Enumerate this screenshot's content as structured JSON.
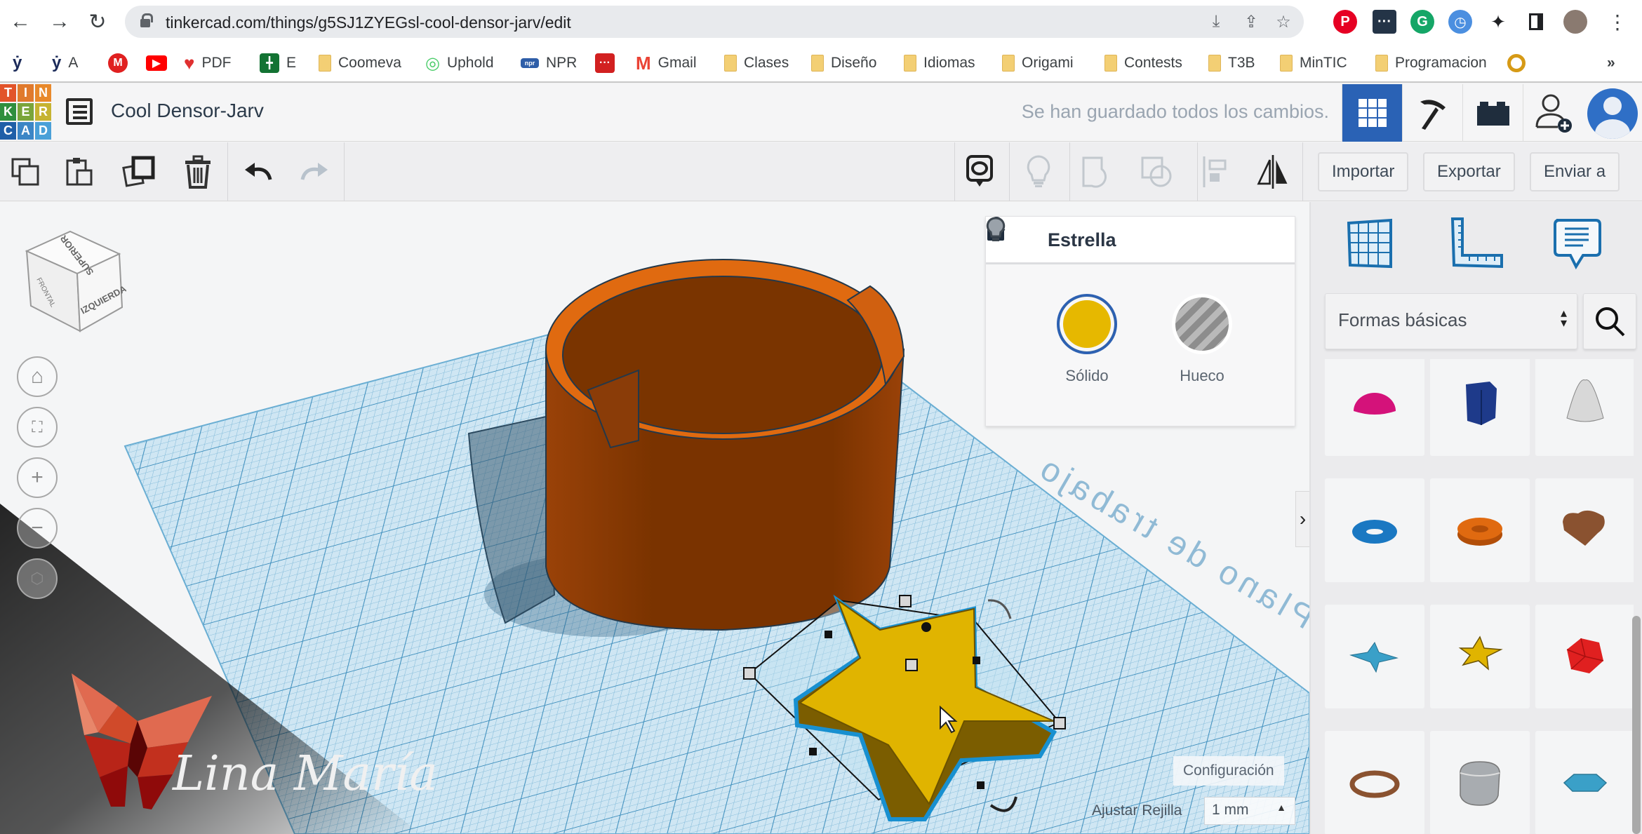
{
  "browser": {
    "url": "tinkercad.com/things/g5SJ1ZYEGsl-cool-densor-jarv/edit",
    "bookmarks": [
      {
        "label": "",
        "icon": "person-icon"
      },
      {
        "label": "A",
        "icon": "person-icon"
      },
      {
        "label": "",
        "icon": "m-badge-icon"
      },
      {
        "label": "",
        "icon": "youtube-icon"
      },
      {
        "label": "PDF",
        "icon": "pdf-heart-icon"
      },
      {
        "label": "E",
        "icon": "sheets-icon"
      },
      {
        "label": "Coomeva",
        "icon": "folder-icon"
      },
      {
        "label": "Uphold",
        "icon": "uphold-icon"
      },
      {
        "label": "NPR",
        "icon": "npr-icon"
      },
      {
        "label": "",
        "icon": "red-dots-icon"
      },
      {
        "label": "Gmail",
        "icon": "gmail-icon"
      },
      {
        "label": "Clases",
        "icon": "folder-icon"
      },
      {
        "label": "Diseño",
        "icon": "folder-icon"
      },
      {
        "label": "Idiomas",
        "icon": "folder-icon"
      },
      {
        "label": "Origami",
        "icon": "folder-icon"
      },
      {
        "label": "Contests",
        "icon": "folder-icon"
      },
      {
        "label": "T3B",
        "icon": "folder-icon"
      },
      {
        "label": "MinTIC",
        "icon": "folder-icon"
      },
      {
        "label": "Programacion",
        "icon": "folder-icon"
      },
      {
        "label": "",
        "icon": "ring-icon"
      }
    ],
    "more_bookmarks": "»"
  },
  "header": {
    "logo_letters": [
      "T",
      "I",
      "N",
      "K",
      "E",
      "R",
      "C",
      "A",
      "D"
    ],
    "logo_colors": [
      "#e2542a",
      "#e07a2d",
      "#e8892b",
      "#2f8f3e",
      "#7aa53a",
      "#c6b332",
      "#1f5fa8",
      "#3c86c6",
      "#4aa0d8"
    ],
    "title": "Cool Densor-Jarv",
    "save_status": "Se han guardado todos los cambios."
  },
  "toolbar": {
    "import_label": "Importar",
    "export_label": "Exportar",
    "send_label": "Enviar a"
  },
  "viewport": {
    "view_cube": {
      "top": "SUPERIOR",
      "front": "FRONTAL",
      "left": "IZQUIERDA"
    },
    "workplane_text": "Plano de trabajo",
    "settings_label": "Configuración",
    "snap_label": "Ajustar Rejilla",
    "snap_value": "1 mm",
    "watermark": "Lina María"
  },
  "shape_panel": {
    "title": "Estrella",
    "solid_label": "Sólido",
    "hole_label": "Hueco",
    "color": "#e6b800"
  },
  "sidebar": {
    "category": "Formas básicas",
    "shapes": [
      {
        "name": "half-sphere",
        "color": "#d4127a"
      },
      {
        "name": "polygon",
        "color": "#1e3a8a"
      },
      {
        "name": "paraboloid",
        "color": "#d8d8d8"
      },
      {
        "name": "torus",
        "color": "#1a78c2"
      },
      {
        "name": "tube",
        "color": "#e06a10"
      },
      {
        "name": "heart",
        "color": "#8a5230"
      },
      {
        "name": "star-pyramid",
        "color": "#3aa0c8"
      },
      {
        "name": "star",
        "color": "#e0b400"
      },
      {
        "name": "icosahedron",
        "color": "#e02020"
      },
      {
        "name": "ring",
        "color": "#8a5230"
      },
      {
        "name": "rounded-box",
        "color": "#a8acb0"
      },
      {
        "name": "hexagon-gem",
        "color": "#3aa0c8"
      }
    ]
  }
}
